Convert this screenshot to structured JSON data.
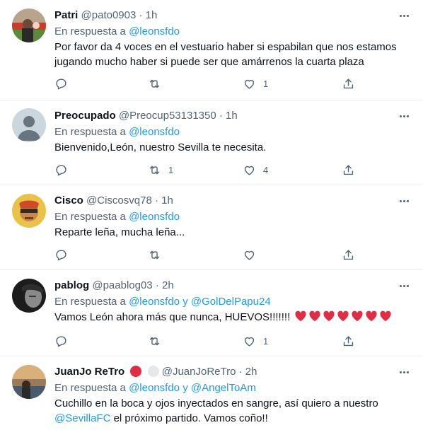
{
  "reply_prefix": "En respuesta a",
  "reply_joiner": "y",
  "tweets": [
    {
      "name": "Patri",
      "handle": "@pato0903",
      "separator": "·",
      "time": "1h",
      "mentions": [
        "@leonsfdo"
      ],
      "text": "Por favor da 4 voces en el vestuario haber si espabilan que nos estamos jugando mucho haber si puede ser que amárrenos la cuarta plaza",
      "replies": "",
      "retweets": "",
      "likes": "1"
    },
    {
      "name": "Preocupado",
      "handle": "@Preocup53131350",
      "separator": "·",
      "time": "1h",
      "mentions": [
        "@leonsfdo"
      ],
      "text": "Bienvenido,León, nuestro Sevilla te necesita.",
      "replies": "",
      "retweets": "1",
      "likes": "4"
    },
    {
      "name": "Cisco",
      "handle": "@Ciscosvq78",
      "separator": "·",
      "time": "1h",
      "mentions": [
        "@leonsfdo"
      ],
      "text": "Reparte leña, mucha leña...",
      "replies": "",
      "retweets": "",
      "likes": ""
    },
    {
      "name": "pablog",
      "handle": "@paablog03",
      "separator": "·",
      "time": "2h",
      "mentions": [
        "@leonsfdo",
        "@GolDelPapu24"
      ],
      "text": "Vamos León ahora más que nunca, HUEVOS!!!!!!!",
      "heart_emoji_count": 7,
      "heart_color": "#dd2e44",
      "replies": "",
      "retweets": "",
      "likes": "1"
    },
    {
      "name": "JuanJo ReTro",
      "handle": "@JuanJoReTro",
      "separator": "·",
      "time": "2h",
      "mentions": [
        "@leonsfdo",
        "@AngelToAm"
      ],
      "text": "Cuchillo en la boca y ojos inyectados en sangre, así quiero a nuestro",
      "text_mention": "@SevillaFC",
      "text_after": "el próximo partido. Vamos coño!!",
      "name_badges": [
        "red-circle",
        "white-circle"
      ]
    }
  ],
  "colors": {
    "text": "#0f1419",
    "secondary": "#536471",
    "link": "#1d9bf0",
    "divider": "#eff3f4"
  },
  "icons": {
    "reply": "reply-icon",
    "retweet": "retweet-icon",
    "like": "like-icon",
    "share": "share-icon",
    "more": "more-icon"
  }
}
